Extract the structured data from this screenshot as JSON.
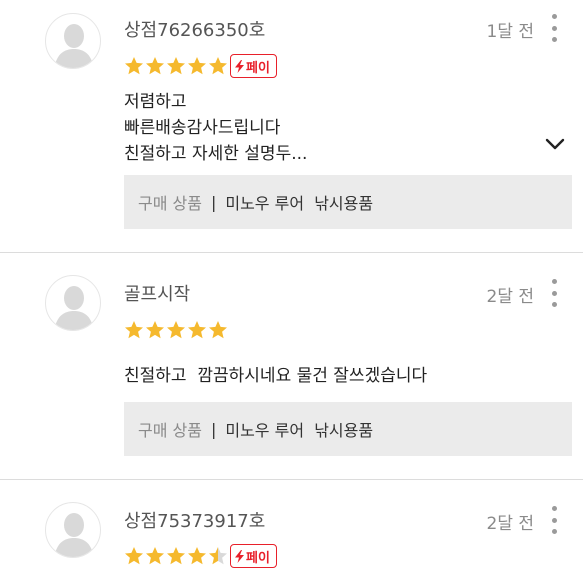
{
  "colors": {
    "star": "#f5b92e",
    "star_empty": "#d9d9d9",
    "pay_badge": "#e8202a",
    "divider": "#dcdcdc",
    "product_bg": "#ebebeb"
  },
  "reviews": [
    {
      "author": "상점76266350호",
      "time": "1달 전",
      "rating": 5,
      "pay_badge": "페이",
      "text": "저렴하고\n빠른배송감사드립니다\n친절하고 자세한 설명두...",
      "product_label": "구매 상품",
      "product_separator": "|",
      "product_name": "미노우 루어  낚시용품"
    },
    {
      "author": "골프시작",
      "time": "2달 전",
      "rating": 5,
      "text": "친절하고  깜끔하시네요 물건 잘쓰겠습니다",
      "product_label": "구매 상품",
      "product_separator": "|",
      "product_name": "미노우 루어  낚시용품"
    },
    {
      "author": "상점75373917호",
      "time": "2달 전",
      "rating": 4.5,
      "pay_badge": "페이"
    }
  ],
  "icons": {
    "avatar": "default-user-icon",
    "more": "more-vertical-icon",
    "expand": "chevron-down-icon",
    "badge": "lightning-icon",
    "star": "star-icon"
  }
}
